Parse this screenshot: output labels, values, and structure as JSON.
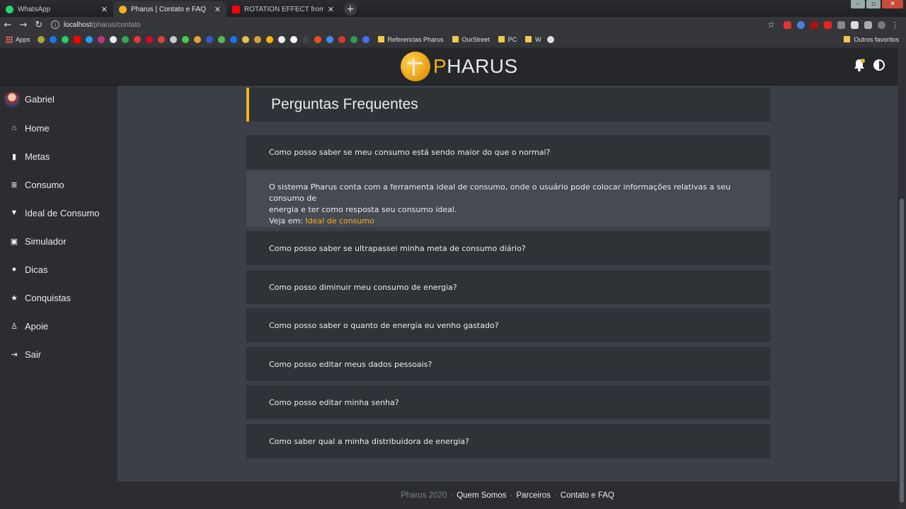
{
  "browser": {
    "tabs": [
      {
        "title": "WhatsApp",
        "color": "#25d366"
      },
      {
        "title": "Pharus | Contato e FAQ",
        "color": "#f0b21a",
        "active": true
      },
      {
        "title": "ROTATION EFFECT from Billie Eili",
        "color": "#ff0000"
      }
    ],
    "new_tab": "+",
    "url_host": "localhost",
    "url_path": "/pharus/contato",
    "bookmarks": {
      "apps_label": "Apps",
      "folders": [
        "Referencias Pharus",
        "OurStreet",
        "PC",
        "W"
      ],
      "others_label": "Outros favoritos"
    }
  },
  "header": {
    "brand_p": "P",
    "brand_rest": "HARUS"
  },
  "sidebar": {
    "user_name": "Gabriel",
    "items": [
      {
        "label": "Home",
        "icon": "home-icon"
      },
      {
        "label": "Metas",
        "icon": "bookmark-icon"
      },
      {
        "label": "Consumo",
        "icon": "coins-icon"
      },
      {
        "label": "Ideal de Consumo",
        "icon": "funnel-icon"
      },
      {
        "label": "Simulador",
        "icon": "laptop-icon"
      },
      {
        "label": "Dicas",
        "icon": "lightbulb-icon"
      },
      {
        "label": "Conquistas",
        "icon": "star-icon"
      },
      {
        "label": "Apoie",
        "icon": "support-icon"
      },
      {
        "label": "Sair",
        "icon": "sign-out-icon"
      }
    ]
  },
  "main": {
    "title": "Perguntas Frequentes",
    "faq": [
      {
        "question": "Como posso saber se meu consumo está sendo maior do que o normal?"
      },
      {
        "question": "Como posso saber se ultrapassei minha meta de consumo diário?"
      },
      {
        "question": "Como posso diminuir meu consumo de energia?"
      },
      {
        "question": "Como posso saber o quanto de energia eu venho gastado?"
      },
      {
        "question": "Como posso editar meus dados pessoais?"
      },
      {
        "question": "Como posso editar minha senha?"
      },
      {
        "question": "Como saber qual a minha distribuidora de energia?"
      }
    ],
    "answer": {
      "text_line1": "O sistema Pharus conta com a ferramenta ideal de consumo, onde o usuário pode colocar informações relativas a seu consumo de",
      "text_line2": "energia e ter como resposta seu consumo ideal.",
      "see_prefix": "Veja em: ",
      "see_link": "Ideal de consumo"
    }
  },
  "footer": {
    "copyright": "Pharus 2020",
    "links": [
      "Quem Somos",
      "Parceiros",
      "Contato e FAQ"
    ],
    "separator": "·"
  }
}
